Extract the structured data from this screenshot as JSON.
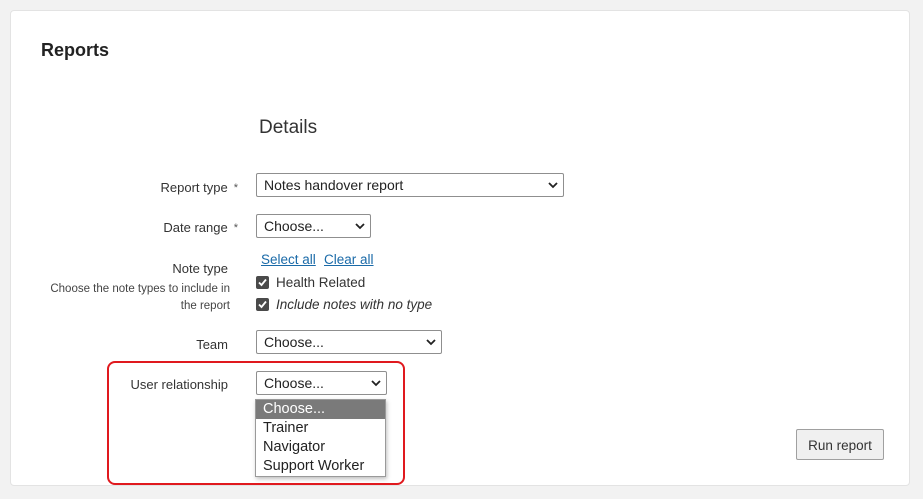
{
  "page": {
    "title": "Reports"
  },
  "form": {
    "section_title": "Details",
    "report_type": {
      "label": "Report type",
      "required_mark": "*",
      "value": "Notes handover report"
    },
    "date_range": {
      "label": "Date range",
      "required_mark": "*",
      "value": "Choose..."
    },
    "note_type": {
      "label": "Note type",
      "help": "Choose the note types to include in the report",
      "select_all": "Select all",
      "clear_all": "Clear all",
      "options": [
        {
          "label": "Health Related",
          "checked": true
        },
        {
          "label": "Include notes with no type",
          "checked": true
        }
      ]
    },
    "team": {
      "label": "Team",
      "value": "Choose..."
    },
    "user_relationship": {
      "label": "User relationship",
      "value": "Choose...",
      "dropdown_options": [
        "Choose...",
        "Trainer",
        "Navigator",
        "Support Worker"
      ],
      "selected_index": 0
    },
    "run_button": "Run report"
  },
  "colors": {
    "highlight": "#e0191e",
    "link": "#1a6aa8",
    "selected_option_bg": "#7a7a7a"
  }
}
